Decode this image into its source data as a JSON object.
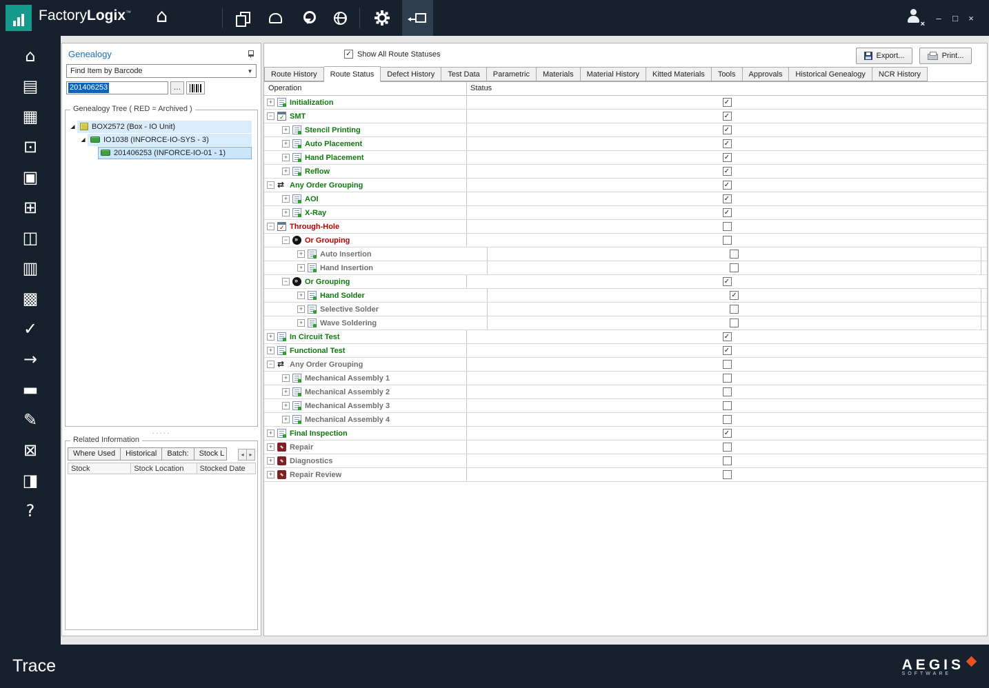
{
  "colors": {
    "titlebar_bg": "#17212D",
    "teal": "#159A8C",
    "title_blue": "#1A6FC0",
    "done_green": "#0E7A0E",
    "pending_red": "#C00000",
    "inactive_gray": "#6F6F6F",
    "selection_blue": "#0A63BD",
    "brand_orange": "#E8511F"
  },
  "titlebar": {
    "app_name_primary": "Factory",
    "app_name_secondary": "Logix",
    "trademark": "™",
    "home_glyph": "⌂",
    "icons": [
      "home-icon",
      "documents-icon",
      "print-preview-icon",
      "location-icon",
      "globe-icon",
      "settings-icon",
      "trace-module-icon",
      "user-signout-icon"
    ],
    "window_buttons": {
      "minimize": "–",
      "maximize": "□",
      "close": "×"
    }
  },
  "sidebar": {
    "items": [
      {
        "name": "home",
        "glyph": "⌂"
      },
      {
        "name": "data-management",
        "glyph": "▤"
      },
      {
        "name": "production",
        "glyph": "▦"
      },
      {
        "name": "trace",
        "glyph": "⊡"
      },
      {
        "name": "workstation",
        "glyph": "▣"
      },
      {
        "name": "data-lookup",
        "glyph": "⊞"
      },
      {
        "name": "warehouse",
        "glyph": "◫"
      },
      {
        "name": "documentation",
        "glyph": "▥"
      },
      {
        "name": "copy",
        "glyph": "▩"
      },
      {
        "name": "verification",
        "glyph": "✓"
      },
      {
        "name": "transfer",
        "glyph": "→"
      },
      {
        "name": "badge",
        "glyph": "▬"
      },
      {
        "name": "notes",
        "glyph": "✎"
      },
      {
        "name": "design",
        "glyph": "⊠"
      },
      {
        "name": "shipping",
        "glyph": "◨"
      },
      {
        "name": "help",
        "glyph": "?"
      }
    ]
  },
  "genealogy": {
    "title": "Genealogy",
    "search_mode": "Find Item by Barcode",
    "barcode_value": "201406253",
    "ellipsis_button": "…",
    "tree_group_label": "Genealogy Tree ( RED = Archived )",
    "tree": [
      {
        "label": "BOX2572 (Box - IO Unit)",
        "level": 0,
        "icon": "box",
        "expanded": true,
        "selected": false
      },
      {
        "label": "IO1038 (INFORCE-IO-SYS - 3)",
        "level": 1,
        "icon": "board",
        "expanded": true,
        "selected": false
      },
      {
        "label": "201406253 (INFORCE-IO-01 - 1)",
        "level": 2,
        "icon": "board",
        "expanded": false,
        "selected": true
      }
    ],
    "splitter_dots": "·····",
    "related": {
      "group_label": "Related Information",
      "tabs": [
        {
          "label": "Where Used",
          "truncated": false
        },
        {
          "label": "Historical",
          "truncated": false
        },
        {
          "label": "Batch:",
          "truncated": false
        },
        {
          "label": "Stock L",
          "truncated": true
        }
      ],
      "scroll_left": "◂",
      "scroll_right": "▸",
      "columns": [
        "Stock",
        "Stock Location",
        "Stocked Date"
      ]
    }
  },
  "main": {
    "show_all_label": "Show All Route Statuses",
    "show_all_checked": true,
    "export_label": "Export...",
    "print_label": "Print...",
    "tabs": [
      "Route History",
      "Route Status",
      "Defect History",
      "Test Data",
      "Parametric",
      "Materials",
      "Material History",
      "Kitted Materials",
      "Tools",
      "Approvals",
      "Historical Genealogy",
      "NCR History"
    ],
    "active_tab": "Route Status",
    "grid": {
      "columns": [
        "Operation",
        "Status"
      ],
      "rows": [
        {
          "label": "Initialization",
          "level": 0,
          "exp": "plus",
          "icon": "script",
          "color": "green",
          "checked": true,
          "nested": false
        },
        {
          "label": "SMT",
          "level": 0,
          "exp": "minus",
          "icon": "process",
          "color": "green",
          "checked": true,
          "nested": false
        },
        {
          "label": "Stencil Printing",
          "level": 1,
          "exp": "plus",
          "icon": "script",
          "color": "green",
          "checked": true,
          "nested": false
        },
        {
          "label": "Auto Placement",
          "level": 1,
          "exp": "plus",
          "icon": "script",
          "color": "green",
          "checked": true,
          "nested": false
        },
        {
          "label": "Hand Placement",
          "level": 1,
          "exp": "plus",
          "icon": "script",
          "color": "green",
          "checked": true,
          "nested": false
        },
        {
          "label": "Reflow",
          "level": 1,
          "exp": "plus",
          "icon": "script",
          "color": "green",
          "checked": true,
          "nested": false
        },
        {
          "label": "Any Order Grouping",
          "level": 0,
          "exp": "minus",
          "icon": "shuffle",
          "color": "green",
          "checked": true,
          "nested": false
        },
        {
          "label": "AOI",
          "level": 1,
          "exp": "plus",
          "icon": "script",
          "color": "green",
          "checked": true,
          "nested": false
        },
        {
          "label": "X-Ray",
          "level": 1,
          "exp": "plus",
          "icon": "script",
          "color": "green",
          "checked": true,
          "nested": false
        },
        {
          "label": "Through-Hole",
          "level": 0,
          "exp": "minus",
          "icon": "process",
          "color": "red",
          "checked": false,
          "nested": false
        },
        {
          "label": "Or Grouping",
          "level": 1,
          "exp": "minus",
          "icon": "or",
          "color": "red",
          "checked": false,
          "nested": false
        },
        {
          "label": "Auto Insertion",
          "level": 2,
          "exp": "plus",
          "icon": "script",
          "color": "gray",
          "checked": false,
          "nested": true
        },
        {
          "label": "Hand Insertion",
          "level": 2,
          "exp": "plus",
          "icon": "script",
          "color": "gray",
          "checked": false,
          "nested": true
        },
        {
          "label": "Or Grouping",
          "level": 1,
          "exp": "minus",
          "icon": "or",
          "color": "green",
          "checked": true,
          "nested": false
        },
        {
          "label": "Hand Solder",
          "level": 2,
          "exp": "plus",
          "icon": "script",
          "color": "green",
          "checked": true,
          "nested": true
        },
        {
          "label": "Selective Solder",
          "level": 2,
          "exp": "plus",
          "icon": "script",
          "color": "gray",
          "checked": false,
          "nested": true
        },
        {
          "label": "Wave Soldering",
          "level": 2,
          "exp": "plus",
          "icon": "script",
          "color": "gray",
          "checked": false,
          "nested": true
        },
        {
          "label": "In Circuit Test",
          "level": 0,
          "exp": "plus",
          "icon": "script",
          "color": "green",
          "checked": true,
          "nested": false
        },
        {
          "label": "Functional Test",
          "level": 0,
          "exp": "plus",
          "icon": "script",
          "color": "green",
          "checked": true,
          "nested": false
        },
        {
          "label": "Any Order Grouping",
          "level": 0,
          "exp": "minus",
          "icon": "shuffle",
          "color": "gray",
          "checked": false,
          "nested": false
        },
        {
          "label": "Mechanical Assembly 1",
          "level": 1,
          "exp": "plus",
          "icon": "script",
          "color": "gray",
          "checked": false,
          "nested": false
        },
        {
          "label": "Mechanical Assembly 2",
          "level": 1,
          "exp": "plus",
          "icon": "script",
          "color": "gray",
          "checked": false,
          "nested": false
        },
        {
          "label": "Mechanical Assembly 3",
          "level": 1,
          "exp": "plus",
          "icon": "script",
          "color": "gray",
          "checked": false,
          "nested": false
        },
        {
          "label": "Mechanical Assembly 4",
          "level": 1,
          "exp": "plus",
          "icon": "script",
          "color": "gray",
          "checked": false,
          "nested": false
        },
        {
          "label": "Final Inspection",
          "level": 0,
          "exp": "plus",
          "icon": "script",
          "color": "green",
          "checked": true,
          "nested": false
        },
        {
          "label": "Repair",
          "level": 0,
          "exp": "plus",
          "icon": "repair",
          "color": "gray",
          "checked": false,
          "nested": false
        },
        {
          "label": "Diagnostics",
          "level": 0,
          "exp": "plus",
          "icon": "repair",
          "color": "gray",
          "checked": false,
          "nested": false
        },
        {
          "label": "Repair Review",
          "level": 0,
          "exp": "plus",
          "icon": "repair",
          "color": "gray",
          "checked": false,
          "nested": false
        }
      ]
    }
  },
  "footer": {
    "module": "Trace",
    "brand": "AEGIS",
    "brand_sub": "SOFTWARE"
  }
}
